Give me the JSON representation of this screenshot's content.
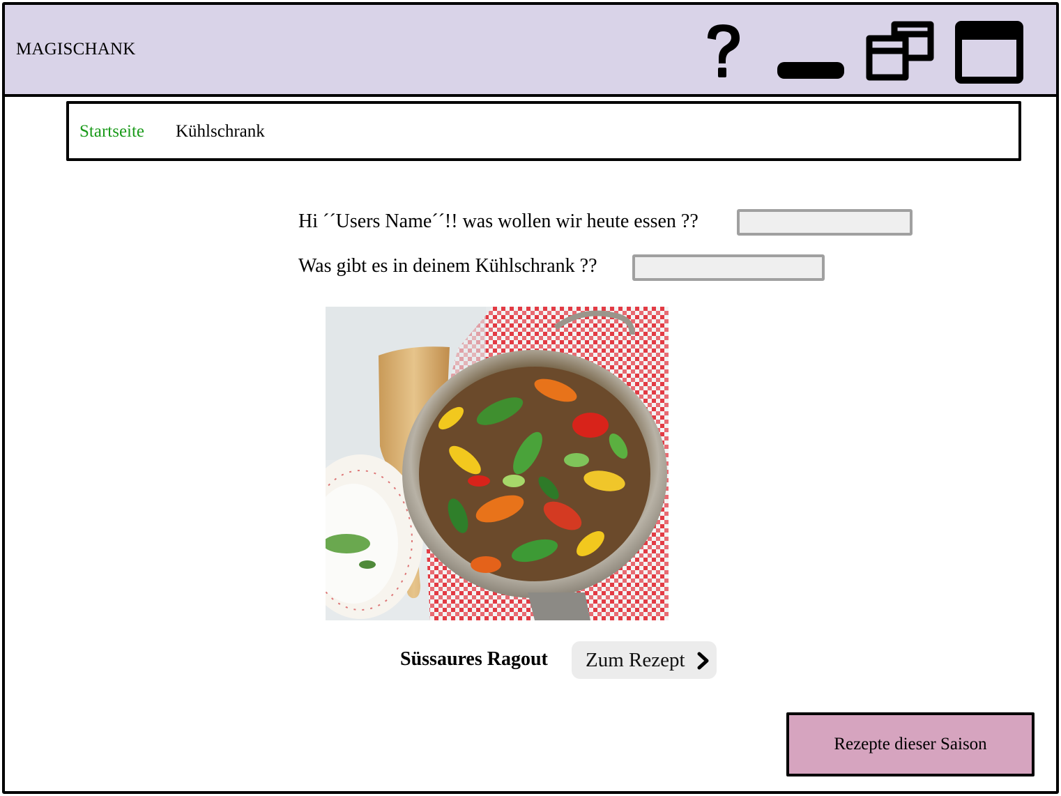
{
  "app": {
    "title": "MAGISCHANK"
  },
  "titlebar": {
    "icons": [
      "help-icon",
      "minimize-icon",
      "restore-icon",
      "maximize-icon"
    ]
  },
  "nav": {
    "items": [
      {
        "label": "Startseite",
        "active": true,
        "color": "#1a9a1a"
      },
      {
        "label": "Kühlschrank",
        "active": false
      }
    ]
  },
  "main": {
    "greeting": "Hi ´´Users Name´´!! was wollen wir heute essen ??",
    "fridge_question": "Was gibt es in deinem Kühlschrank ??",
    "recipe": {
      "name": "Süssaures Ragout",
      "button_label": "Zum Rezept",
      "image": "stir-fried-vegetables-wok-photo"
    },
    "season_button": "Rezepte dieser Saison"
  },
  "colors": {
    "titlebar_bg": "#d9d3e8",
    "season_button_bg": "#d6a4bf",
    "nav_active": "#1a9a1a",
    "field_bg": "#efefef"
  }
}
